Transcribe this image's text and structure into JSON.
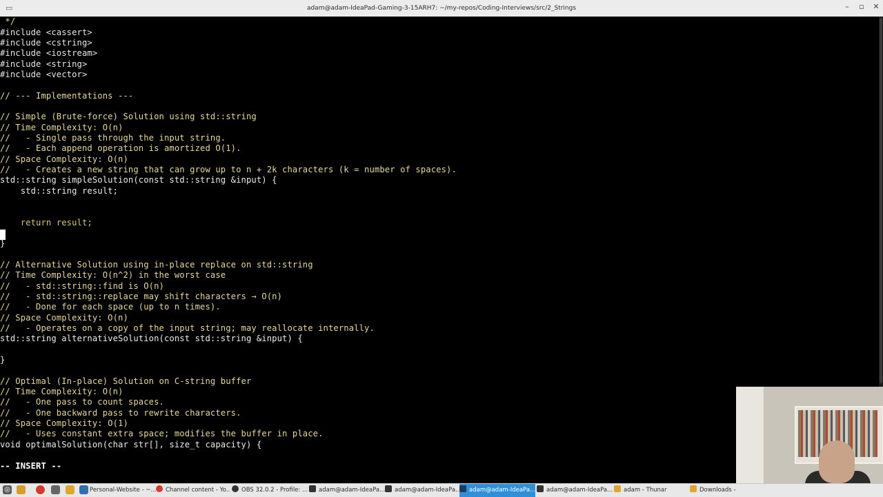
{
  "window": {
    "title": "adam@adam-IdeaPad-Gaming-3-15ARH7: ~/my-repos/Coding-Interviews/src/2_Strings",
    "controls": {
      "minimize": "–",
      "maximize": "▫",
      "close": "✕"
    }
  },
  "editor": {
    "lines": [
      " */",
      "#include <cassert>",
      "#include <cstring>",
      "#include <iostream>",
      "#include <string>",
      "#include <vector>",
      "",
      "// --- Implementations ---",
      "",
      "// Simple (Brute-force) Solution using std::string",
      "// Time Complexity: O(n)",
      "//   - Single pass through the input string.",
      "//   - Each append operation is amortized O(1).",
      "// Space Complexity: O(n)",
      "//   - Creates a new string that can grow up to n + 2k characters (k = number of spaces).",
      "std::string simpleSolution(const std::string &input) {",
      "    std::string result;",
      "",
      "",
      "    return result;",
      "",
      "}",
      "",
      "// Alternative Solution using in-place replace on std::string",
      "// Time Complexity: O(n^2) in the worst case",
      "//   - std::string::find is O(n)",
      "//   - std::string::replace may shift characters → O(n)",
      "//   - Done for each space (up to n times).",
      "// Space Complexity: O(n)",
      "//   - Operates on a copy of the input string; may reallocate internally.",
      "std::string alternativeSolution(const std::string &input) {",
      "",
      "}",
      "",
      "// Optimal (In-place) Solution on C-string buffer",
      "// Time Complexity: O(n)",
      "//   - One pass to count spaces.",
      "//   - One backward pass to rewrite characters.",
      "// Space Complexity: O(1)",
      "//   - Uses constant extra space; modifies the buffer in place.",
      "void optimalSolution(char str[], size_t capacity) {",
      "",
      "-- INSERT --"
    ],
    "mode": "-- INSERT --"
  },
  "taskbar": {
    "items": [
      {
        "label": "Personal-Website - ~...",
        "active": false
      },
      {
        "label": "Channel content - Yo...",
        "active": false
      },
      {
        "label": "OBS 32.0.2 - Profile: ...",
        "active": false
      },
      {
        "label": "adam@adam-IdeaPa...",
        "active": false
      },
      {
        "label": "adam@adam-IdeaPa...",
        "active": false
      },
      {
        "label": "adam@adam-IdeaPa...",
        "active": true
      },
      {
        "label": "adam@adam-IdeaPa...",
        "active": false
      },
      {
        "label": "adam - Thunar",
        "active": false
      },
      {
        "label": "Downloads -",
        "active": false
      }
    ]
  },
  "colors": {
    "terminal_bg": "#000000",
    "comment": "#e6d79a",
    "taskbar_active": "#2f8fd8"
  }
}
